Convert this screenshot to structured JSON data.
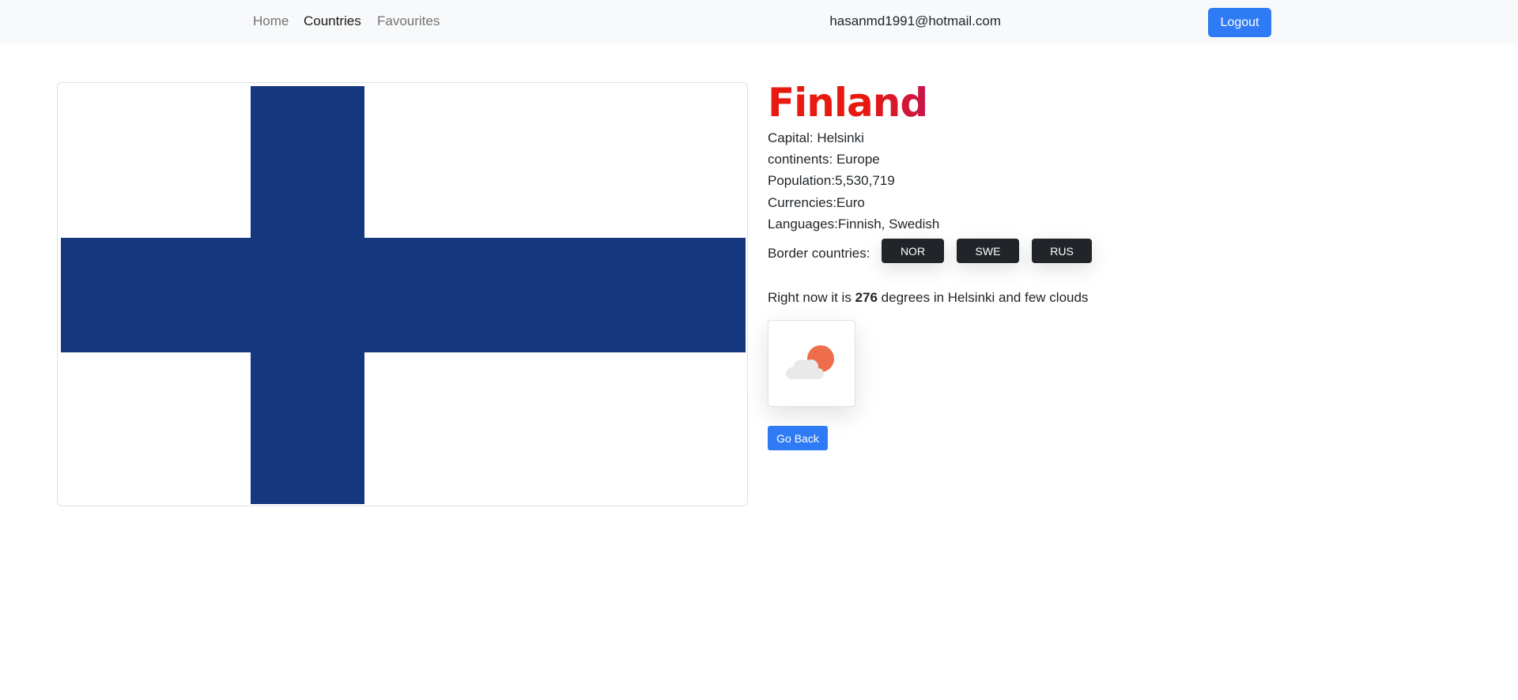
{
  "nav": {
    "home": "Home",
    "countries": "Countries",
    "favourites": "Favourites",
    "user_email": "hasanmd1991@hotmail.com",
    "logout": "Logout"
  },
  "country": {
    "name": "Finland",
    "capital": "Capital: Helsinki",
    "continents": "continents: Europe",
    "population": "Population:5,530,719",
    "currencies": "Currencies:Euro",
    "languages": "Languages:Finnish, Swedish",
    "border_label": "Border countries:",
    "borders": [
      "NOR",
      "SWE",
      "RUS"
    ]
  },
  "flag": {
    "background_color": "#ffffff",
    "cross_color": "#153780"
  },
  "weather": {
    "prefix": "Right now it is",
    "temperature": "276",
    "suffix": "degrees in Helsinki and few clouds",
    "icon": "few-clouds-day-icon"
  },
  "actions": {
    "go_back": "Go Back"
  },
  "colors": {
    "primary": "#2f7bf5",
    "dark_button": "#212529",
    "title_red": "#e8190f"
  }
}
